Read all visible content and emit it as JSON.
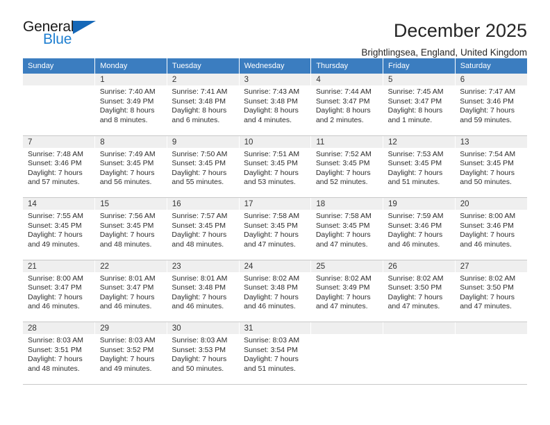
{
  "brand": {
    "name_part1": "General",
    "name_part2": "Blue",
    "triangle_icon": "triangle-icon",
    "accent_color": "#1f7fd0",
    "triangle_color": "#1668b8"
  },
  "header": {
    "title": "December 2025",
    "subtitle": "Brightlingsea, England, United Kingdom"
  },
  "calendar": {
    "header_bg": "#3b7dc0",
    "daynum_bg": "#efefef",
    "weekday_headers": [
      "Sunday",
      "Monday",
      "Tuesday",
      "Wednesday",
      "Thursday",
      "Friday",
      "Saturday"
    ],
    "weeks": [
      {
        "days": [
          {
            "num": "",
            "sunrise": "",
            "sunset": "",
            "daylight1": "",
            "daylight2": ""
          },
          {
            "num": "1",
            "sunrise": "Sunrise: 7:40 AM",
            "sunset": "Sunset: 3:49 PM",
            "daylight1": "Daylight: 8 hours",
            "daylight2": "and 8 minutes."
          },
          {
            "num": "2",
            "sunrise": "Sunrise: 7:41 AM",
            "sunset": "Sunset: 3:48 PM",
            "daylight1": "Daylight: 8 hours",
            "daylight2": "and 6 minutes."
          },
          {
            "num": "3",
            "sunrise": "Sunrise: 7:43 AM",
            "sunset": "Sunset: 3:48 PM",
            "daylight1": "Daylight: 8 hours",
            "daylight2": "and 4 minutes."
          },
          {
            "num": "4",
            "sunrise": "Sunrise: 7:44 AM",
            "sunset": "Sunset: 3:47 PM",
            "daylight1": "Daylight: 8 hours",
            "daylight2": "and 2 minutes."
          },
          {
            "num": "5",
            "sunrise": "Sunrise: 7:45 AM",
            "sunset": "Sunset: 3:47 PM",
            "daylight1": "Daylight: 8 hours",
            "daylight2": "and 1 minute."
          },
          {
            "num": "6",
            "sunrise": "Sunrise: 7:47 AM",
            "sunset": "Sunset: 3:46 PM",
            "daylight1": "Daylight: 7 hours",
            "daylight2": "and 59 minutes."
          }
        ]
      },
      {
        "days": [
          {
            "num": "7",
            "sunrise": "Sunrise: 7:48 AM",
            "sunset": "Sunset: 3:46 PM",
            "daylight1": "Daylight: 7 hours",
            "daylight2": "and 57 minutes."
          },
          {
            "num": "8",
            "sunrise": "Sunrise: 7:49 AM",
            "sunset": "Sunset: 3:45 PM",
            "daylight1": "Daylight: 7 hours",
            "daylight2": "and 56 minutes."
          },
          {
            "num": "9",
            "sunrise": "Sunrise: 7:50 AM",
            "sunset": "Sunset: 3:45 PM",
            "daylight1": "Daylight: 7 hours",
            "daylight2": "and 55 minutes."
          },
          {
            "num": "10",
            "sunrise": "Sunrise: 7:51 AM",
            "sunset": "Sunset: 3:45 PM",
            "daylight1": "Daylight: 7 hours",
            "daylight2": "and 53 minutes."
          },
          {
            "num": "11",
            "sunrise": "Sunrise: 7:52 AM",
            "sunset": "Sunset: 3:45 PM",
            "daylight1": "Daylight: 7 hours",
            "daylight2": "and 52 minutes."
          },
          {
            "num": "12",
            "sunrise": "Sunrise: 7:53 AM",
            "sunset": "Sunset: 3:45 PM",
            "daylight1": "Daylight: 7 hours",
            "daylight2": "and 51 minutes."
          },
          {
            "num": "13",
            "sunrise": "Sunrise: 7:54 AM",
            "sunset": "Sunset: 3:45 PM",
            "daylight1": "Daylight: 7 hours",
            "daylight2": "and 50 minutes."
          }
        ]
      },
      {
        "days": [
          {
            "num": "14",
            "sunrise": "Sunrise: 7:55 AM",
            "sunset": "Sunset: 3:45 PM",
            "daylight1": "Daylight: 7 hours",
            "daylight2": "and 49 minutes."
          },
          {
            "num": "15",
            "sunrise": "Sunrise: 7:56 AM",
            "sunset": "Sunset: 3:45 PM",
            "daylight1": "Daylight: 7 hours",
            "daylight2": "and 48 minutes."
          },
          {
            "num": "16",
            "sunrise": "Sunrise: 7:57 AM",
            "sunset": "Sunset: 3:45 PM",
            "daylight1": "Daylight: 7 hours",
            "daylight2": "and 48 minutes."
          },
          {
            "num": "17",
            "sunrise": "Sunrise: 7:58 AM",
            "sunset": "Sunset: 3:45 PM",
            "daylight1": "Daylight: 7 hours",
            "daylight2": "and 47 minutes."
          },
          {
            "num": "18",
            "sunrise": "Sunrise: 7:58 AM",
            "sunset": "Sunset: 3:45 PM",
            "daylight1": "Daylight: 7 hours",
            "daylight2": "and 47 minutes."
          },
          {
            "num": "19",
            "sunrise": "Sunrise: 7:59 AM",
            "sunset": "Sunset: 3:46 PM",
            "daylight1": "Daylight: 7 hours",
            "daylight2": "and 46 minutes."
          },
          {
            "num": "20",
            "sunrise": "Sunrise: 8:00 AM",
            "sunset": "Sunset: 3:46 PM",
            "daylight1": "Daylight: 7 hours",
            "daylight2": "and 46 minutes."
          }
        ]
      },
      {
        "days": [
          {
            "num": "21",
            "sunrise": "Sunrise: 8:00 AM",
            "sunset": "Sunset: 3:47 PM",
            "daylight1": "Daylight: 7 hours",
            "daylight2": "and 46 minutes."
          },
          {
            "num": "22",
            "sunrise": "Sunrise: 8:01 AM",
            "sunset": "Sunset: 3:47 PM",
            "daylight1": "Daylight: 7 hours",
            "daylight2": "and 46 minutes."
          },
          {
            "num": "23",
            "sunrise": "Sunrise: 8:01 AM",
            "sunset": "Sunset: 3:48 PM",
            "daylight1": "Daylight: 7 hours",
            "daylight2": "and 46 minutes."
          },
          {
            "num": "24",
            "sunrise": "Sunrise: 8:02 AM",
            "sunset": "Sunset: 3:48 PM",
            "daylight1": "Daylight: 7 hours",
            "daylight2": "and 46 minutes."
          },
          {
            "num": "25",
            "sunrise": "Sunrise: 8:02 AM",
            "sunset": "Sunset: 3:49 PM",
            "daylight1": "Daylight: 7 hours",
            "daylight2": "and 47 minutes."
          },
          {
            "num": "26",
            "sunrise": "Sunrise: 8:02 AM",
            "sunset": "Sunset: 3:50 PM",
            "daylight1": "Daylight: 7 hours",
            "daylight2": "and 47 minutes."
          },
          {
            "num": "27",
            "sunrise": "Sunrise: 8:02 AM",
            "sunset": "Sunset: 3:50 PM",
            "daylight1": "Daylight: 7 hours",
            "daylight2": "and 47 minutes."
          }
        ]
      },
      {
        "days": [
          {
            "num": "28",
            "sunrise": "Sunrise: 8:03 AM",
            "sunset": "Sunset: 3:51 PM",
            "daylight1": "Daylight: 7 hours",
            "daylight2": "and 48 minutes."
          },
          {
            "num": "29",
            "sunrise": "Sunrise: 8:03 AM",
            "sunset": "Sunset: 3:52 PM",
            "daylight1": "Daylight: 7 hours",
            "daylight2": "and 49 minutes."
          },
          {
            "num": "30",
            "sunrise": "Sunrise: 8:03 AM",
            "sunset": "Sunset: 3:53 PM",
            "daylight1": "Daylight: 7 hours",
            "daylight2": "and 50 minutes."
          },
          {
            "num": "31",
            "sunrise": "Sunrise: 8:03 AM",
            "sunset": "Sunset: 3:54 PM",
            "daylight1": "Daylight: 7 hours",
            "daylight2": "and 51 minutes."
          },
          {
            "num": "",
            "sunrise": "",
            "sunset": "",
            "daylight1": "",
            "daylight2": ""
          },
          {
            "num": "",
            "sunrise": "",
            "sunset": "",
            "daylight1": "",
            "daylight2": ""
          },
          {
            "num": "",
            "sunrise": "",
            "sunset": "",
            "daylight1": "",
            "daylight2": ""
          }
        ]
      }
    ]
  }
}
